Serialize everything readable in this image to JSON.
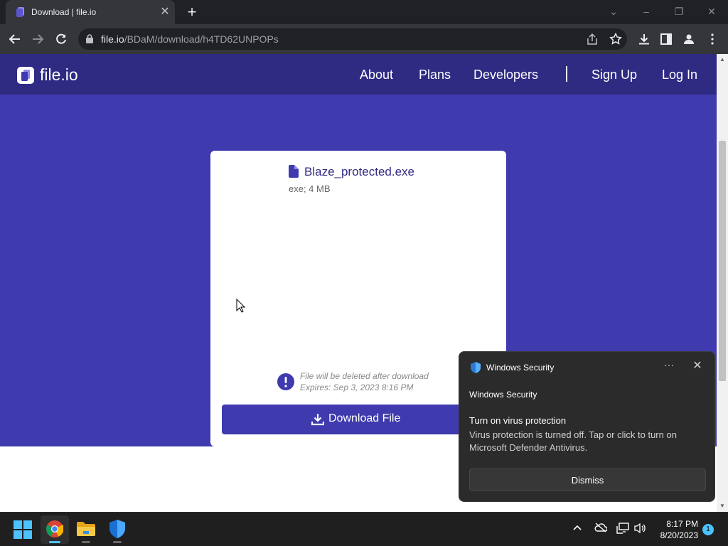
{
  "browser": {
    "tab_title": "Download | file.io",
    "url_host": "file.io",
    "url_path": "/BDaM/download/h4TD62UNPOPs"
  },
  "site": {
    "logo_text": "file.io",
    "nav": {
      "about": "About",
      "plans": "Plans",
      "developers": "Developers",
      "signup": "Sign Up",
      "login": "Log In"
    },
    "file": {
      "name": "Blaze_protected.exe",
      "info": "exe; 4 MB",
      "note_line1": "File will be deleted after download",
      "note_line2": "Expires: Sep 3, 2023 8:16 PM"
    },
    "download_label": "Download File"
  },
  "toast": {
    "app_name": "Windows Security",
    "subtitle": "Windows Security",
    "heading": "Turn on virus protection",
    "body": "Virus protection is turned off. Tap or click to turn on Microsoft Defender Antivirus.",
    "dismiss_label": "Dismiss",
    "more_label": "···"
  },
  "taskbar": {
    "time": "8:17 PM",
    "date": "8/20/2023",
    "notification_count": "1"
  },
  "colors": {
    "brand": "#2f2b83",
    "brand_light": "#3f3aad"
  },
  "icons": {
    "favicon": "file-io-favicon-icon",
    "lock": "lock-icon",
    "share": "share-icon",
    "star": "star-icon",
    "download": "download-icon",
    "sidepanel": "side-panel-icon",
    "profile": "profile-icon",
    "menu": "kebab-menu-icon",
    "file": "file-icon",
    "warning": "exclamation-icon",
    "shield": "windows-security-shield-icon"
  }
}
